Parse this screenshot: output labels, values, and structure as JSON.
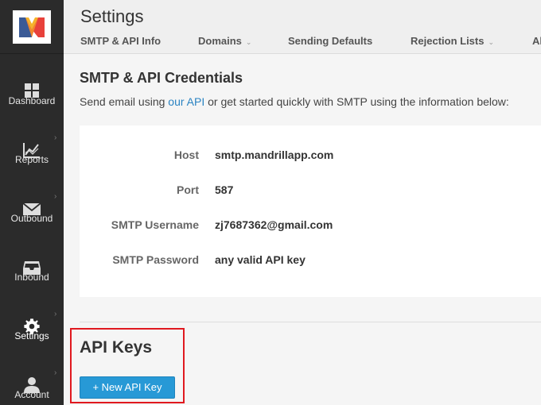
{
  "header": {
    "title": "Settings",
    "tabs": [
      {
        "label": "SMTP & API Info",
        "has_dropdown": false
      },
      {
        "label": "Domains",
        "has_dropdown": true
      },
      {
        "label": "Sending Defaults",
        "has_dropdown": false
      },
      {
        "label": "Rejection Lists",
        "has_dropdown": true
      },
      {
        "label": "Al",
        "has_dropdown": false
      }
    ]
  },
  "sidebar": {
    "items": [
      {
        "label": "Dashboard",
        "icon": "dashboard-grid-icon"
      },
      {
        "label": "Reports",
        "icon": "reports-chart-icon"
      },
      {
        "label": "Outbound",
        "icon": "envelope-icon"
      },
      {
        "label": "Inbound",
        "icon": "inbox-tray-icon"
      },
      {
        "label": "Settings",
        "icon": "gear-icon",
        "active": true
      },
      {
        "label": "Account",
        "icon": "user-icon"
      }
    ]
  },
  "main": {
    "section_title": "SMTP & API Credentials",
    "intro_before": "Send email using ",
    "intro_link": "our API",
    "intro_after": " or get started quickly with SMTP using the information below:",
    "credentials": [
      {
        "label": "Host",
        "value": "smtp.mandrillapp.com"
      },
      {
        "label": "Port",
        "value": "587"
      },
      {
        "label": "SMTP Username",
        "value": "zj7687362@gmail.com"
      },
      {
        "label": "SMTP Password",
        "value": "any valid API key"
      }
    ],
    "api_keys_title": "API Keys",
    "new_key_button": "+ New API Key"
  },
  "colors": {
    "sidebar_bg": "#2b2b2b",
    "link": "#2a83c2",
    "button": "#2799d6",
    "highlight": "#e0191f",
    "logo_red": "#e8413b",
    "logo_yellow": "#f5b32a",
    "logo_blue": "#3a5a96"
  }
}
